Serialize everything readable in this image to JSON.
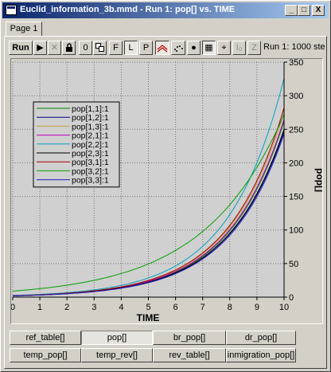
{
  "window": {
    "title": "Euclid_information_3b.mmd - Run 1: pop[] vs. TIME",
    "minimize": "_",
    "maximize": "□",
    "close": "X"
  },
  "page_tab": "Page 1",
  "toolbar": {
    "run": "Run",
    "play": "▶",
    "stop": "✕",
    "lock": "🔒",
    "zero": "0",
    "copy": "⧉",
    "f": "F",
    "l": "L",
    "p": "P",
    "lines_icon": "lines-icon",
    "scatter_icon": "scatter-icon",
    "dot": "●",
    "grid": "▦",
    "crosshair": "⌖",
    "io": "I₀",
    "z": "Z",
    "status": "Run 1: 1000 ste"
  },
  "bottom_tabs": [
    [
      "ref_table[]",
      "pop[]",
      "br_pop[]",
      "dr_pop[]"
    ],
    [
      "temp_pop[]",
      "temp_rev[]",
      "rev_table[]",
      "inmigration_pop[]"
    ]
  ],
  "active_tab": "pop[]",
  "chart_data": {
    "type": "line",
    "xlabel": "TIME",
    "ylabel": "pop[]",
    "xlim": [
      0,
      10
    ],
    "ylim": [
      0,
      350
    ],
    "xticks": [
      0,
      1,
      2,
      3,
      4,
      5,
      6,
      7,
      8,
      9,
      10
    ],
    "yticks": [
      0,
      50,
      100,
      150,
      200,
      250,
      300,
      350
    ],
    "grid": true,
    "legend_position": "top-left",
    "series": [
      {
        "name": "pop[1,1]:1",
        "color": "#008000",
        "y0": 2.0,
        "y10": 262
      },
      {
        "name": "pop[1,2]:1",
        "color": "#00008b",
        "y0": 2.0,
        "y10": 247
      },
      {
        "name": "pop[1,3]:1",
        "color": "#c8a040",
        "y0": 2.2,
        "y10": 275
      },
      {
        "name": "pop[2,1]:1",
        "color": "#c000c0",
        "y0": 2.1,
        "y10": 265
      },
      {
        "name": "pop[2,2]:1",
        "color": "#00a0c0",
        "y0": 2.5,
        "y10": 326
      },
      {
        "name": "pop[2,3]:1",
        "color": "#000000",
        "y0": 2.0,
        "y10": 250
      },
      {
        "name": "pop[3,1]:1",
        "color": "#a00000",
        "y0": 2.2,
        "y10": 282
      },
      {
        "name": "pop[3,2]:1",
        "color": "#00a000",
        "y0": 9.0,
        "y10": 272
      },
      {
        "name": "pop[3,3]:1",
        "color": "#2020c0",
        "y0": 1.9,
        "y10": 243
      }
    ]
  }
}
